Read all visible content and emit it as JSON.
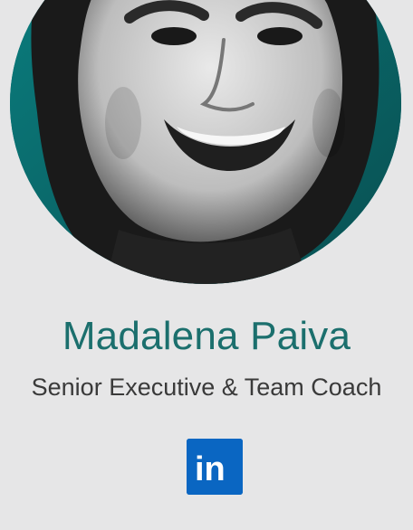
{
  "profile": {
    "name": "Madalena Paiva",
    "role": "Senior Executive & Team Coach"
  },
  "social": {
    "linkedin_label": "in"
  },
  "colors": {
    "background": "#e6e6e7",
    "accent": "#1b6f6d",
    "avatar_teal": "#0c6f70",
    "linkedin_blue": "#0a66c2"
  },
  "icons": {
    "avatar": "portrait-photo",
    "linkedin": "linkedin-icon"
  }
}
